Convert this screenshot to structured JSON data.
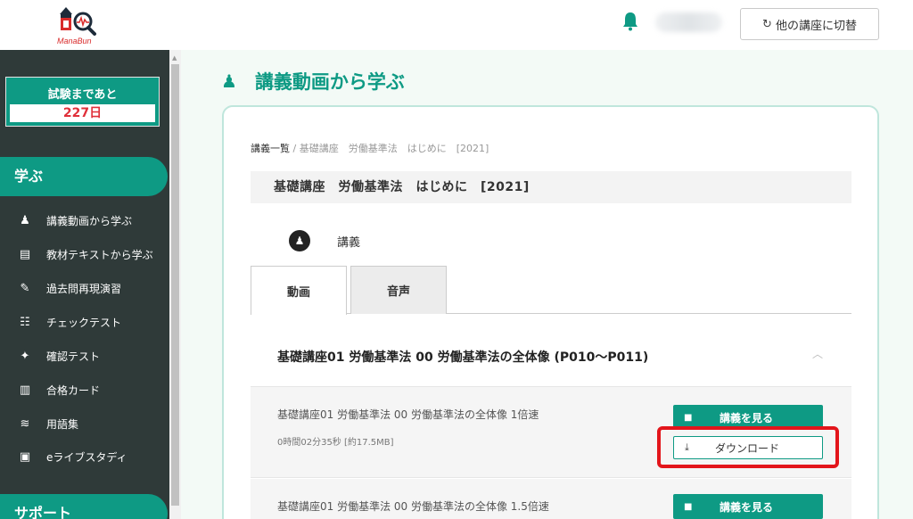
{
  "header": {
    "logo_text": "ManaBun",
    "switch_label": "他の講座に切替",
    "icons": {
      "bell": "bell-icon",
      "refresh": "refresh-icon"
    },
    "accent": "#0e9a84"
  },
  "sidebar": {
    "countdown_label": "試験まであと",
    "countdown_value": "227日",
    "section_learn": "学ぶ",
    "items": [
      {
        "label": "講義動画から学ぶ",
        "icon": "lecturer-icon"
      },
      {
        "label": "教材テキストから学ぶ",
        "icon": "book-icon"
      },
      {
        "label": "過去問再現演習",
        "icon": "edit-icon"
      },
      {
        "label": "チェックテスト",
        "icon": "checklist-icon"
      },
      {
        "label": "確認テスト",
        "icon": "puzzle-icon"
      },
      {
        "label": "合格カード",
        "icon": "card-icon"
      },
      {
        "label": "用語集",
        "icon": "glossary-icon"
      },
      {
        "label": "eライブスタディ",
        "icon": "monitor-icon"
      }
    ],
    "section_support": "サポート"
  },
  "main": {
    "page_title": "講義動画から学ぶ",
    "breadcrumb": {
      "home": "講義一覧",
      "sep": "/",
      "current": "基礎講座　労働基準法　はじめに　[2021]"
    },
    "lecture_title": "基礎講座　労働基準法　はじめに　[2021]",
    "lecture_type": "講義",
    "tabs": [
      {
        "label": "動画",
        "active": true
      },
      {
        "label": "音声",
        "active": false
      }
    ],
    "chapter_title": "基礎講座01 労働基準法 00 労働基準法の全体像 (P010～P011)",
    "videos": [
      {
        "title": "基礎講座01 労働基準法 00 労働基準法の全体像 1倍速",
        "meta": "0時間02分35秒 [約17.5MB]",
        "watch_label": "講義を見る",
        "download_label": "ダウンロード"
      },
      {
        "title": "基礎講座01 労働基準法 00 労働基準法の全体像 1.5倍速",
        "watch_label": "講義を見る"
      }
    ]
  }
}
